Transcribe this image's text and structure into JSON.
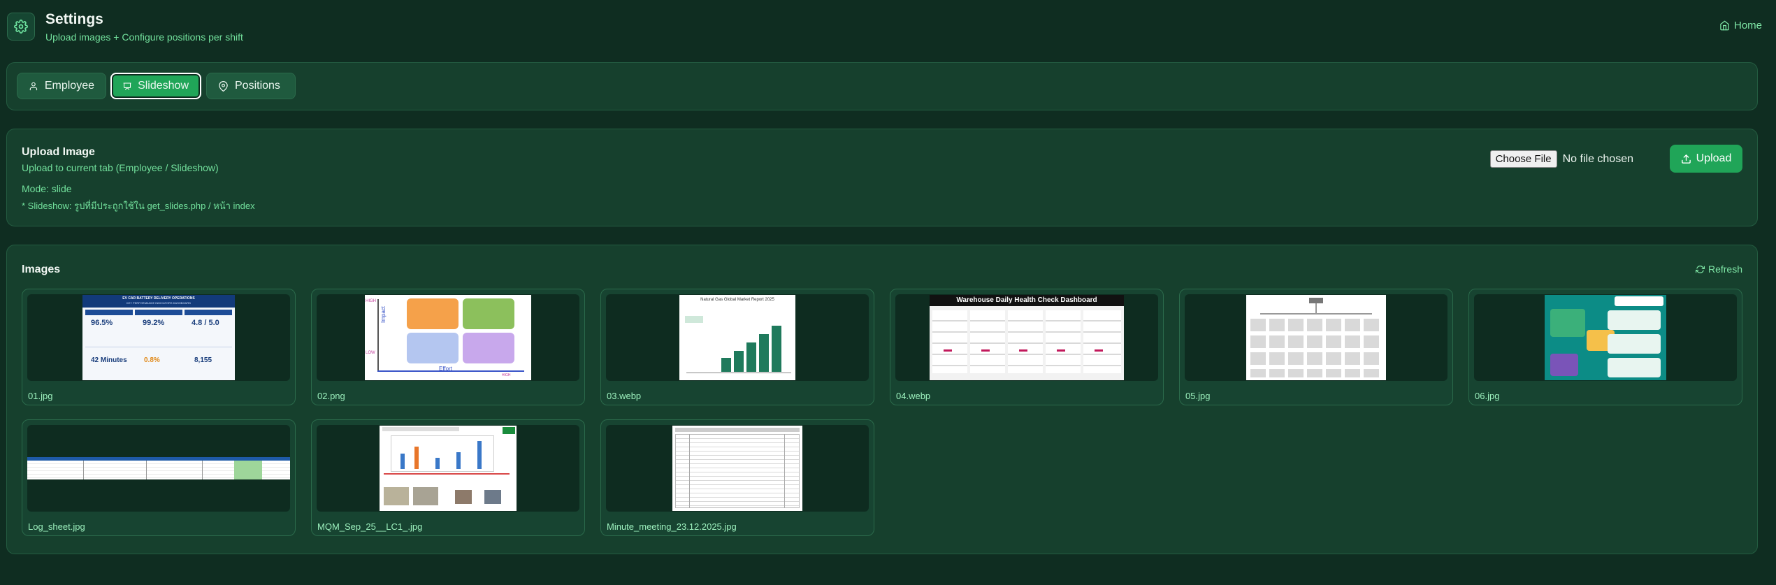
{
  "header": {
    "title": "Settings",
    "subtitle": "Upload images + Configure positions per shift",
    "home_label": "Home"
  },
  "tabs": [
    {
      "label": "Employee",
      "active": false
    },
    {
      "label": "Slideshow",
      "active": true
    },
    {
      "label": "Positions",
      "active": false
    }
  ],
  "upload": {
    "title": "Upload Image",
    "subtitle": "Upload to current tab (Employee / Slideshow)",
    "mode": "Mode: slide",
    "note": "* Slideshow: รูปที่มีประถูกใช้ใน get_slides.php / หน้า index",
    "choose_label": "Choose File",
    "file_status": "No file chosen",
    "upload_label": "Upload"
  },
  "images": {
    "title": "Images",
    "refresh_label": "Refresh",
    "items": [
      {
        "name": "01.jpg",
        "thumb_title": "EV CAR BATTERY DELIVERY OPERATIONS",
        "thumb_sub": "KEY PERFORMANCE INDICATORS DASHBOARD",
        "kpis": [
          "96.5%",
          "99.2%",
          "4.8 / 5.0",
          "42 Minutes",
          "0.8%",
          "8,155"
        ]
      },
      {
        "name": "02.png",
        "axis_y": "Impact",
        "axis_x": "Effort",
        "high": "HIGH",
        "low": "LOW"
      },
      {
        "name": "03.webp",
        "thumb_title": "Natural Gas Global Market Report 2025"
      },
      {
        "name": "04.webp",
        "thumb_title": "Warehouse Daily Health Check Dashboard"
      },
      {
        "name": "05.jpg"
      },
      {
        "name": "06.jpg"
      },
      {
        "name": "Log_sheet.jpg"
      },
      {
        "name": "MQM_Sep_25__LC1_.jpg"
      },
      {
        "name": "Minute_meeting_23.12.2025.jpg"
      }
    ]
  },
  "colors": {
    "background": "#0f2d21",
    "panel": "#16402d",
    "accent": "#20a558",
    "accent_text": "#72e09c"
  },
  "icons": {
    "logo": "gear-icon",
    "home": "home-icon",
    "employee": "user-icon",
    "slideshow": "presentation-icon",
    "positions": "map-pin-icon",
    "upload": "upload-icon",
    "refresh": "refresh-icon"
  }
}
